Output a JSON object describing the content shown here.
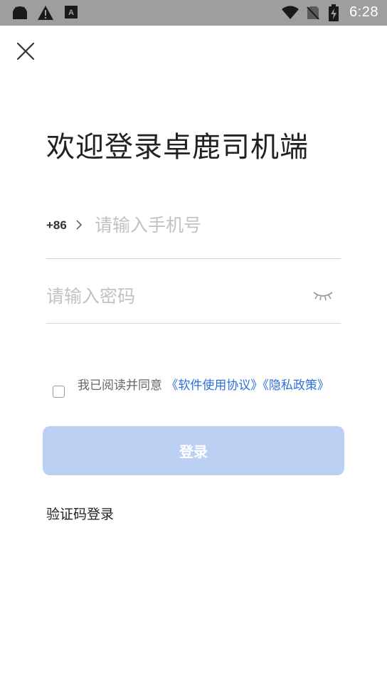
{
  "status_bar": {
    "time": "6:28",
    "icons": [
      "android-icon",
      "warning-icon",
      "font-icon",
      "wifi-icon",
      "no-sim-icon",
      "battery-charging-icon"
    ]
  },
  "header": {
    "close_icon": "close-icon"
  },
  "title": "欢迎登录卓鹿司机端",
  "phone": {
    "country_code": "+86",
    "placeholder": "请输入手机号",
    "value": ""
  },
  "password": {
    "placeholder": "请输入密码",
    "value": "",
    "toggle_icon": "eye-closed-icon"
  },
  "agreement": {
    "prefix": "我已阅读并同意",
    "software_agreement": "《软件使用协议》",
    "privacy_policy": "《隐私政策》",
    "checked": false
  },
  "login_button": "登录",
  "sms_login_link": "验证码登录",
  "colors": {
    "accent": "#2f6fdc",
    "button_disabled": "#bcd0f4",
    "status_bar": "#9e9e9e"
  }
}
